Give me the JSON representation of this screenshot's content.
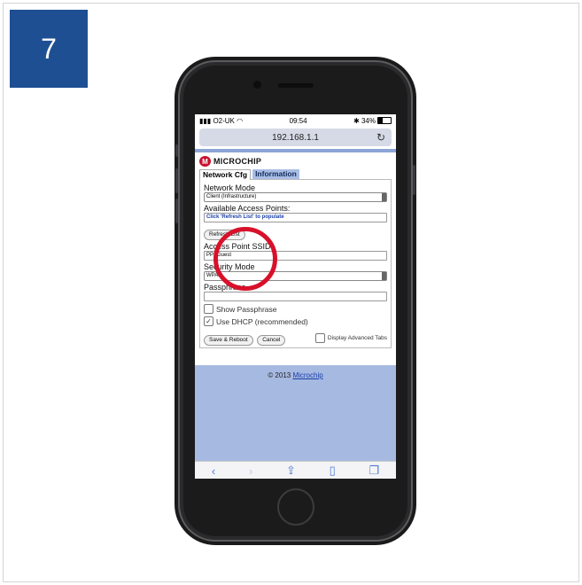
{
  "step_number": "7",
  "status_bar": {
    "carrier": "O2-UK",
    "time": "09:54",
    "battery": "34%"
  },
  "browser": {
    "url": "192.168.1.1"
  },
  "brand": {
    "logo_mark": "M",
    "logo_text": "MICROCHIP"
  },
  "tabs": [
    {
      "label": "Network Cfg"
    },
    {
      "label": "Information"
    }
  ],
  "form": {
    "network_mode_label": "Network Mode",
    "network_mode_value": "Client (Infrastructure)",
    "available_ap_label": "Available Access Points:",
    "available_ap_hint": "Click 'Refresh List' to populate",
    "refresh_button": "Refresh List",
    "ssid_label": "Access Point SSID",
    "ssid_value": "PPSGuest",
    "security_label": "Security Mode",
    "security_value": "WPA2",
    "passphrase_label": "Passphrase",
    "passphrase_value": "",
    "show_passphrase_label": "Show Passphrase",
    "use_dhcp_label": "Use DHCP (recommended)",
    "save_button": "Save & Reboot",
    "cancel_button": "Cancel",
    "advanced_tabs_label": "Display Advanced Tabs"
  },
  "footer": {
    "copyright": "© 2013 ",
    "link": "Microchip"
  },
  "accent_color": "#1f4f93",
  "highlight_color": "#d8102a"
}
